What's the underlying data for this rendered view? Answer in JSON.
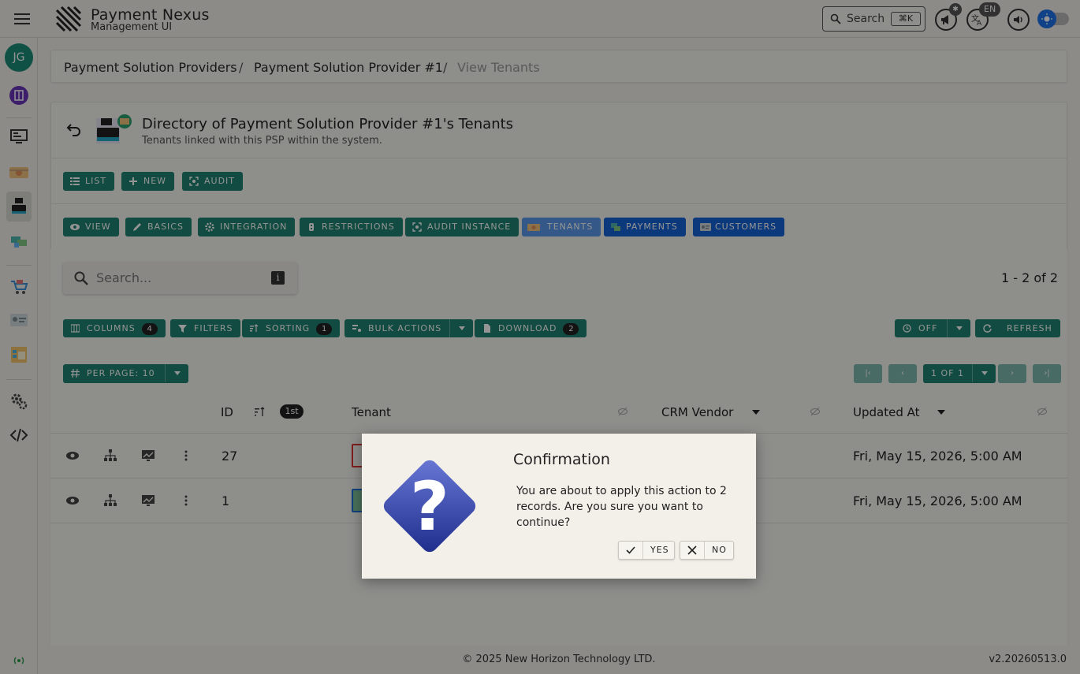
{
  "app": {
    "title": "Payment Nexus",
    "subtitle": "Management UI",
    "search_label": "Search",
    "search_shortcut": "⌘K",
    "notifications_badge": "",
    "language": "EN"
  },
  "sidebar": {
    "avatar_initials": "JG",
    "items": [
      "dashboard",
      "payment-methods",
      "psp",
      "integrations",
      "shopping",
      "customers",
      "reports",
      "settings",
      "developer"
    ]
  },
  "breadcrumb": {
    "items": [
      "Payment Solution Providers",
      "Payment Solution Provider #1",
      "View Tenants"
    ]
  },
  "header": {
    "title": "Directory of Payment Solution Provider #1's Tenants",
    "subtitle": "Tenants linked with this PSP within the system."
  },
  "actions_top": [
    "LIST",
    "NEW",
    "AUDIT"
  ],
  "actions_instance": [
    "VIEW",
    "BASICS",
    "INTEGRATION",
    "RESTRICTIONS",
    "AUDIT INSTANCE",
    "TENANTS",
    "PAYMENTS",
    "CUSTOMERS"
  ],
  "grid": {
    "search_placeholder": "Search...",
    "count_text": "1 - 2 of 2",
    "toolbar": {
      "columns": "COLUMNS",
      "columns_count": "4",
      "filters": "FILTERS",
      "sorting": "SORTING",
      "sorting_count": "1",
      "bulk": "BULK ACTIONS",
      "download": "DOWNLOAD",
      "download_count": "2",
      "auto": "OFF",
      "refresh": "REFRESH"
    },
    "per_page": "PER PAGE:  10",
    "page_of": "1 OF 1",
    "columns": [
      "ID",
      "Tenant",
      "CRM Vendor",
      "Updated At"
    ],
    "sort_badge": "1st",
    "rows": [
      {
        "id": "27",
        "updated": "Fri, May 15, 2026, 5:00 AM"
      },
      {
        "id": "1",
        "updated": "Fri, May 15, 2026, 5:00 AM"
      }
    ]
  },
  "dialog": {
    "title": "Confirmation",
    "message": "You are about to apply this action to 2 records. Are you sure you want to continue?",
    "yes": "YES",
    "no": "NO"
  },
  "footer": {
    "copyright": "© 2025 New Horizon Technology LTD.",
    "version": "v2.20260513.0"
  },
  "colors": {
    "accent": "#1e8170",
    "blue": "#1363d6",
    "avatar": "#1d8c77"
  }
}
